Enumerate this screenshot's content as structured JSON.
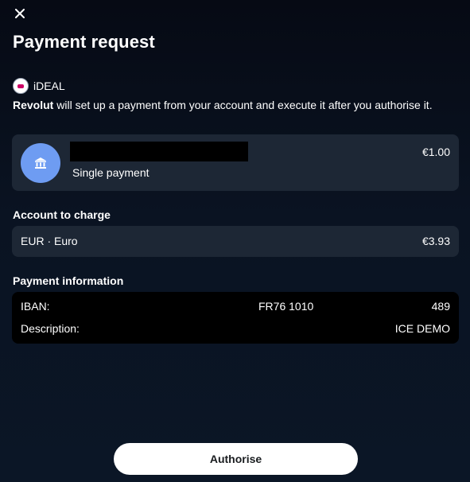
{
  "header": {
    "close_icon": "close-icon",
    "title": "Payment request"
  },
  "provider": {
    "logo_icon": "ideal-logo-icon",
    "name": "iDEAL"
  },
  "intro": {
    "brand": "Revolut",
    "text": " will set up a payment from your account and execute it after you authorise it."
  },
  "payee": {
    "avatar_icon": "bank-icon",
    "name_redacted": true,
    "type": "Single payment",
    "amount": "€1.00"
  },
  "account": {
    "section_label": "Account to charge",
    "name": "EUR · Euro",
    "balance": "€3.93"
  },
  "payment_info": {
    "section_label": "Payment information",
    "iban_label": "IBAN:",
    "iban_start": "FR76 1010",
    "iban_end": "489",
    "description_label": "Description:",
    "description_value": "ICE DEMO"
  },
  "actions": {
    "authorise_label": "Authorise"
  },
  "colors": {
    "background": "#060a14",
    "card": "#1d2735",
    "avatar": "#6e9cf2",
    "button": "#ffffff",
    "ideal_brand": "#cc0066"
  }
}
